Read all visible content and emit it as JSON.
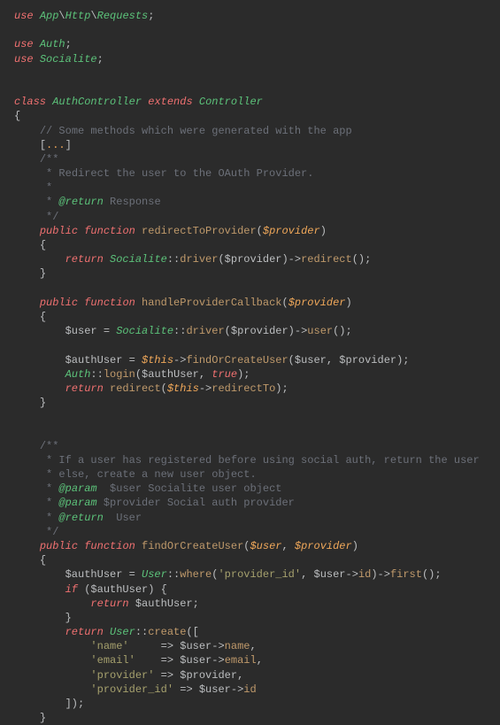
{
  "lines": {
    "l01a": "use",
    "l01b": "App",
    "l01c": "Http",
    "l01d": "Requests",
    "l02a": "use",
    "l02b": "Auth",
    "l03a": "use",
    "l03b": "Socialite",
    "l04a": "class",
    "l04b": "AuthController",
    "l04c": "extends",
    "l04d": "Controller",
    "l05": "{",
    "l06": "// Some methods which were generated with the app",
    "l07a": "[",
    "l07b": "...",
    "l07c": "]",
    "l08": "/**",
    "l09": " * Redirect the user to the OAuth Provider.",
    "l10": " *",
    "l11a": " * ",
    "l11b": "@return",
    "l11c": " Response",
    "l12": " */",
    "l13a": "public",
    "l13b": "function",
    "l13c": "redirectToProvider",
    "l13d": "$provider",
    "l14": "{",
    "l15a": "return",
    "l15b": "Socialite",
    "l15c": "driver",
    "l15d": "redirect",
    "l16": "}",
    "l17a": "public",
    "l17b": "function",
    "l17c": "handleProviderCallback",
    "l17d": "$provider",
    "l18": "{",
    "l19a": "$user",
    "l19b": "Socialite",
    "l19c": "driver",
    "l19d": "user",
    "l20a": "$authUser",
    "l20b": "$this",
    "l20c": "findOrCreateUser",
    "l20d": "$user",
    "l20e": "$provider",
    "l21a": "Auth",
    "l21b": "login",
    "l21c": "$authUser",
    "l21d": "true",
    "l22a": "return",
    "l22b": "redirect",
    "l22c": "$this",
    "l22d": "redirectTo",
    "l23": "}",
    "l24": "/**",
    "l25": " * If a user has registered before using social auth, return the user",
    "l26": " * else, create a new user object.",
    "l27a": " * ",
    "l27b": "@param",
    "l27c": "  $user Socialite user object",
    "l28a": " * ",
    "l28b": "@param",
    "l28c": " $provider Social auth provider",
    "l29a": " * ",
    "l29b": "@return",
    "l29c": "  User",
    "l30": " */",
    "l31a": "public",
    "l31b": "function",
    "l31c": "findOrCreateUser",
    "l31d": "$user",
    "l31e": "$provider",
    "l32": "{",
    "l33a": "$authUser",
    "l33b": "User",
    "l33c": "where",
    "l33d": "'provider_id'",
    "l33e": "$user",
    "l33f": "id",
    "l33g": "first",
    "l34a": "if",
    "l34b": "$authUser",
    "l35a": "return",
    "l35b": "$authUser",
    "l36": "}",
    "l37a": "return",
    "l37b": "User",
    "l37c": "create",
    "l38a": "'name'",
    "l38b": "$user",
    "l38c": "name",
    "l39a": "'email'",
    "l39b": "$user",
    "l39c": "email",
    "l40a": "'provider'",
    "l40b": "$provider",
    "l41a": "'provider_id'",
    "l41b": "$user",
    "l41c": "id",
    "l42": "]);",
    "l43": "}"
  }
}
